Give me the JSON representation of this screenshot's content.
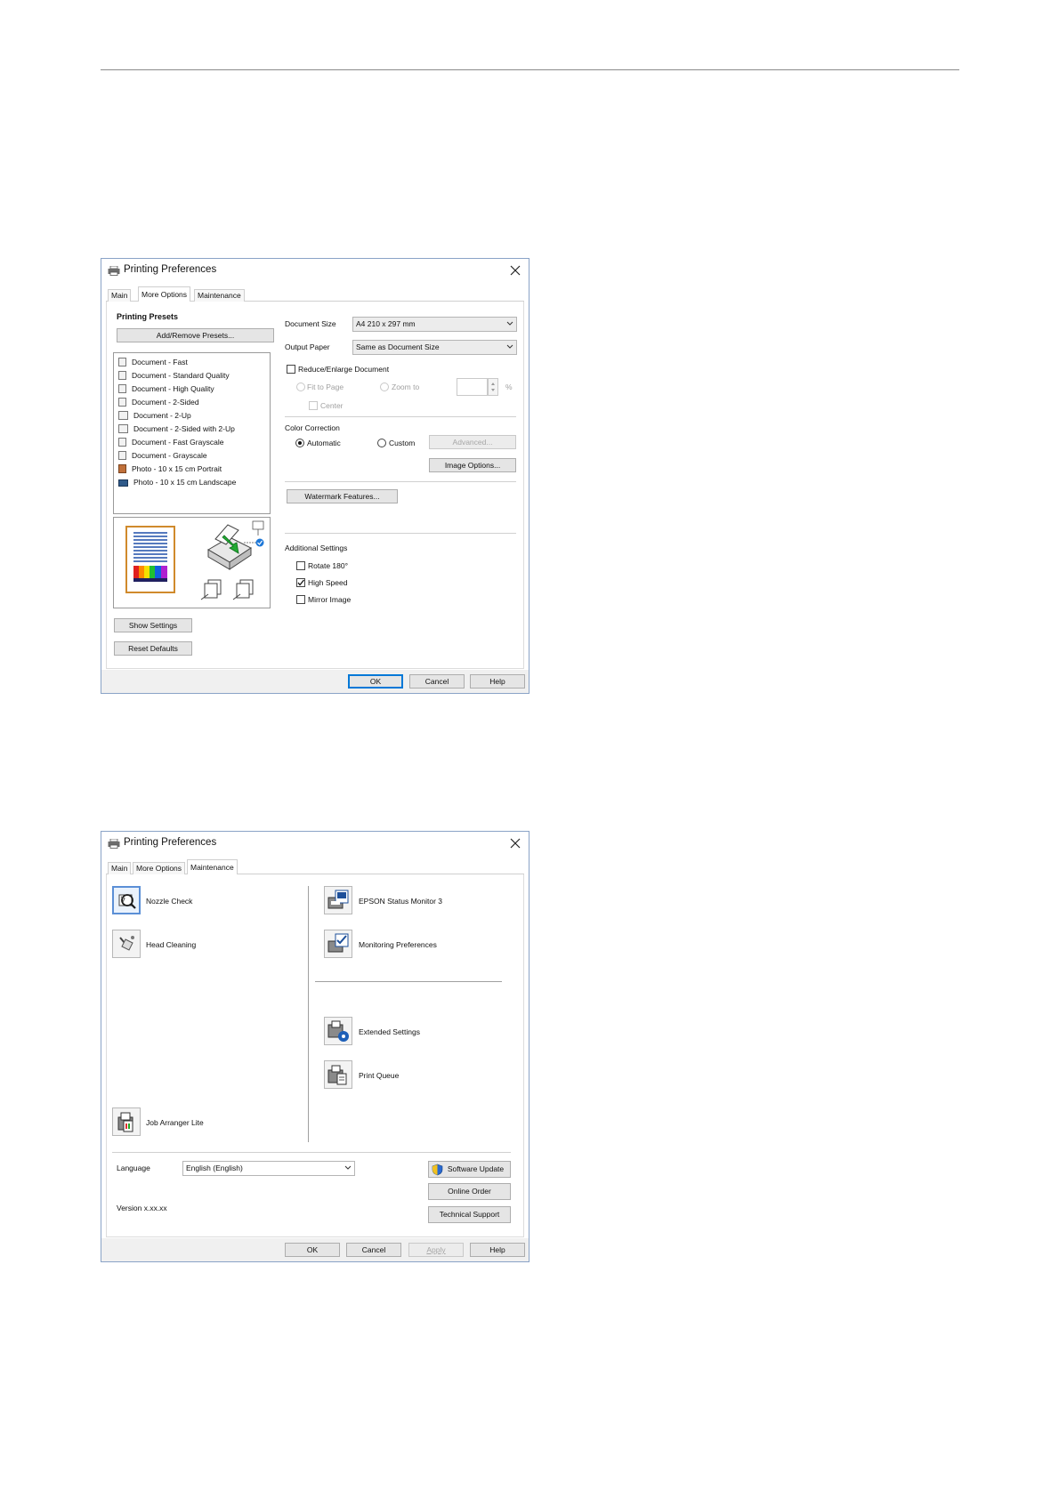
{
  "dialog1": {
    "title": "Printing Preferences",
    "tabs": [
      "Main",
      "More Options",
      "Maintenance"
    ],
    "presets": {
      "heading": "Printing Presets",
      "add_remove": "Add/Remove Presets...",
      "items": [
        "Document - Fast",
        "Document - Standard Quality",
        "Document - High Quality",
        "Document - 2-Sided",
        "Document - 2-Up",
        "Document - 2-Sided with 2-Up",
        "Document - Fast Grayscale",
        "Document - Grayscale",
        "Photo - 10 x 15 cm Portrait",
        "Photo - 10 x 15 cm Landscape"
      ]
    },
    "document_size": {
      "label": "Document Size",
      "value": "A4 210 x 297 mm"
    },
    "output_paper": {
      "label": "Output Paper",
      "value": "Same as Document Size"
    },
    "reduce_enlarge": "Reduce/Enlarge Document",
    "fit_to_page": "Fit to Page",
    "zoom_to": "Zoom to",
    "percent": "%",
    "center": "Center",
    "color_correction": {
      "heading": "Color Correction",
      "automatic": "Automatic",
      "custom": "Custom",
      "advanced": "Advanced...",
      "image_options": "Image Options..."
    },
    "watermark": "Watermark Features...",
    "additional": {
      "heading": "Additional Settings",
      "rotate": "Rotate 180°",
      "high_speed": "High Speed",
      "mirror": "Mirror Image"
    },
    "show_settings": "Show Settings",
    "reset_defaults": "Reset Defaults",
    "footer": {
      "ok": "OK",
      "cancel": "Cancel",
      "help": "Help"
    }
  },
  "dialog2": {
    "title": "Printing Preferences",
    "tabs": [
      "Main",
      "More Options",
      "Maintenance"
    ],
    "tools_left": {
      "nozzle_check": "Nozzle Check",
      "head_cleaning": "Head Cleaning",
      "job_arranger": "Job Arranger Lite"
    },
    "tools_right": {
      "status_monitor": "EPSON Status Monitor 3",
      "monitoring_prefs": "Monitoring Preferences",
      "extended_settings": "Extended Settings",
      "print_queue": "Print Queue"
    },
    "language": {
      "label": "Language",
      "value": "English (English)"
    },
    "version": "Version x.xx.xx",
    "software_update": "Software Update",
    "online_order": "Online Order",
    "technical_support": "Technical Support",
    "footer": {
      "ok": "OK",
      "cancel": "Cancel",
      "apply": "Apply",
      "help": "Help"
    }
  },
  "colors": {
    "accent_blue": "#0078d7",
    "dialog_border": "#8aa3c7",
    "footer_bg": "#f0f0f0",
    "button_bg": "#e5e5e5"
  }
}
